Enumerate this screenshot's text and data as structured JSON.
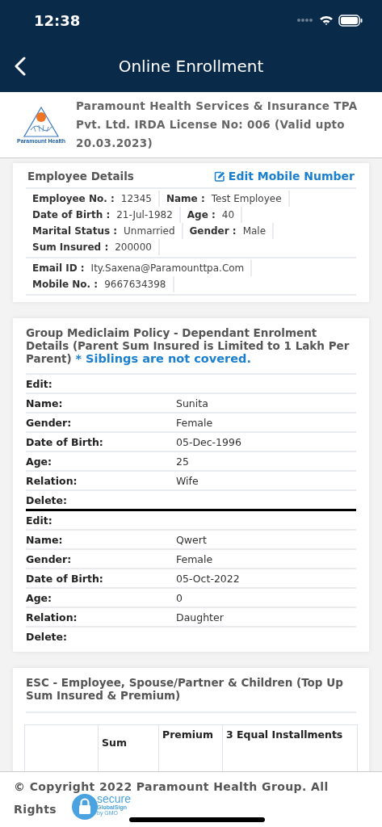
{
  "status_bar": {
    "time": "12:38"
  },
  "nav": {
    "title": "Online Enrollment"
  },
  "header": {
    "logo_text": "Paramount Health",
    "company": "Paramount Health Services & Insurance TPA Pvt. Ltd. IRDA License No: 006 (Valid upto 20.03.2023)"
  },
  "employee_details": {
    "title": "Employee Details",
    "edit_link": "Edit Mobile Number",
    "groups": [
      [
        {
          "label": "Employee No. :",
          "value": "12345"
        },
        {
          "label": "Name :",
          "value": "Test Employee"
        },
        {
          "label": "Date of Birth :",
          "value": "21-Jul-1982"
        },
        {
          "label": "Age :",
          "value": "40"
        },
        {
          "label": "Marital Status :",
          "value": "Unmarried"
        },
        {
          "label": "Gender :",
          "value": "Male"
        },
        {
          "label": "Sum Insured :",
          "value": "200000"
        }
      ],
      [
        {
          "label": "Email ID :",
          "value": "Ity.Saxena@Paramounttpa.Com"
        },
        {
          "label": "Mobile No. :",
          "value": "9667634398"
        }
      ]
    ]
  },
  "dependants": {
    "title": "Group Mediclaim Policy - Dependant Enrolment Details (Parent Sum Insured is Limited to 1 Lakh Per Parent)",
    "note": "* Siblings are not covered.",
    "records": [
      [
        {
          "label": "Edit:"
        },
        {
          "label": "Name:",
          "value": "Sunita"
        },
        {
          "label": "Gender:",
          "value": "Female"
        },
        {
          "label": "Date of Birth:",
          "value": "05-Dec-1996"
        },
        {
          "label": "Age:",
          "value": "25"
        },
        {
          "label": "Relation:",
          "value": "Wife"
        },
        {
          "label": "Delete:"
        }
      ],
      [
        {
          "label": "Edit:"
        },
        {
          "label": "Name:",
          "value": "Qwert"
        },
        {
          "label": "Gender:",
          "value": "Female"
        },
        {
          "label": "Date of Birth:",
          "value": "05-Oct-2022"
        },
        {
          "label": "Age:",
          "value": "0"
        },
        {
          "label": "Relation:",
          "value": "Daughter"
        },
        {
          "label": "Delete:"
        }
      ]
    ]
  },
  "esc": {
    "title": "ESC - Employee, Spouse/Partner & Children (Top Up Sum Insured & Premium)",
    "columns": [
      "Sum",
      "Premium",
      "3 Equal Installments"
    ]
  },
  "footer": {
    "copyright_lines": [
      "© Copyright 2022 Paramount Health Group. All",
      "Rights"
    ],
    "badge": {
      "word": "secure",
      "brand": "GlobalSign",
      "by": "by GMO"
    }
  }
}
